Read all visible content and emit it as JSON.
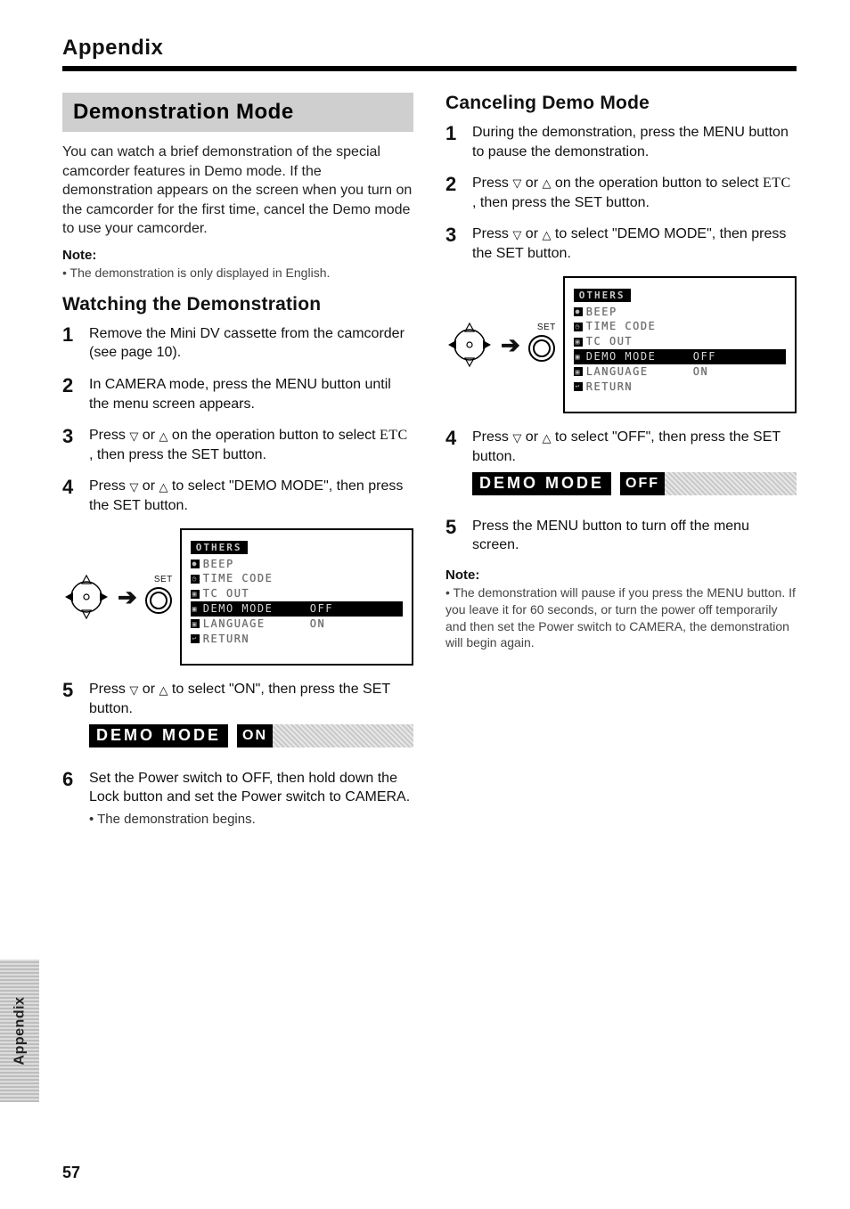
{
  "header": {
    "section": "Appendix"
  },
  "banner": {
    "title": "Demonstration Mode"
  },
  "intro": "You can watch a brief demonstration of the special camcorder features in Demo mode. If the demonstration appears on the screen when you turn on the camcorder for the first time, cancel the Demo mode to use your camcorder.",
  "note1": {
    "label": "Note:",
    "text": "• The demonstration is only displayed in English."
  },
  "subheads": {
    "watching": "Watching the Demonstration",
    "canceling": "Canceling Demo Mode"
  },
  "glyphs": {
    "triDown": "▽",
    "triUp": "△",
    "arrow": "➔",
    "etc": "ETC",
    "setLabel": "SET"
  },
  "watch_steps": [
    {
      "n": "1",
      "text": "Remove the Mini DV cassette from the camcorder (see page 10)."
    },
    {
      "n": "2",
      "text": "In CAMERA mode, press the MENU button until the menu screen appears."
    },
    {
      "n": "3",
      "pre": "Press ",
      "mid": " on the operation button to select ",
      "post": ", then press the SET button."
    },
    {
      "n": "4",
      "pre": "Press ",
      "post": " to select \"DEMO MODE\", then press the SET button."
    },
    {
      "n": "5",
      "pre": "Press ",
      "post": " to select \"ON\", then press the SET button."
    },
    {
      "n": "6",
      "text": "Set the Power switch to OFF, then hold down the Lock button and set the Power switch to CAMERA.",
      "sub": "• The demonstration begins."
    }
  ],
  "cancel_steps": [
    {
      "n": "1",
      "text": "During the demonstration, press the MENU button to pause the demonstration."
    },
    {
      "n": "2",
      "pre": "Press ",
      "mid": " on the operation button to select ",
      "post": ", then press the SET button."
    },
    {
      "n": "3",
      "pre": "Press ",
      "post": " to select \"DEMO MODE\", then press the SET button."
    },
    {
      "n": "4",
      "pre": "Press ",
      "post": " to select \"OFF\", then press the SET button."
    },
    {
      "n": "5",
      "text": "Press the MENU button to turn off the menu screen."
    }
  ],
  "menu": {
    "title": "OTHERS",
    "rows": [
      {
        "name": "BEEP",
        "val": ""
      },
      {
        "name": "TIME CODE",
        "val": ""
      },
      {
        "name": "TC OUT",
        "val": ""
      },
      {
        "name": "DEMO MODE",
        "val": "OFF",
        "sel": true
      },
      {
        "name": "LANGUAGE",
        "val": "ON"
      },
      {
        "name": "RETURN",
        "val": ""
      }
    ]
  },
  "demo_bar": {
    "label": "DEMO MODE",
    "on": "ON",
    "off": "OFF"
  },
  "note2": {
    "label": "Note:",
    "text": "• The demonstration will pause if you press the MENU button. If you leave it for 60 seconds, or turn the power off temporarily and then set the Power switch to CAMERA, the demonstration will begin again."
  },
  "sideTab": "Appendix",
  "pageNumber": "57"
}
